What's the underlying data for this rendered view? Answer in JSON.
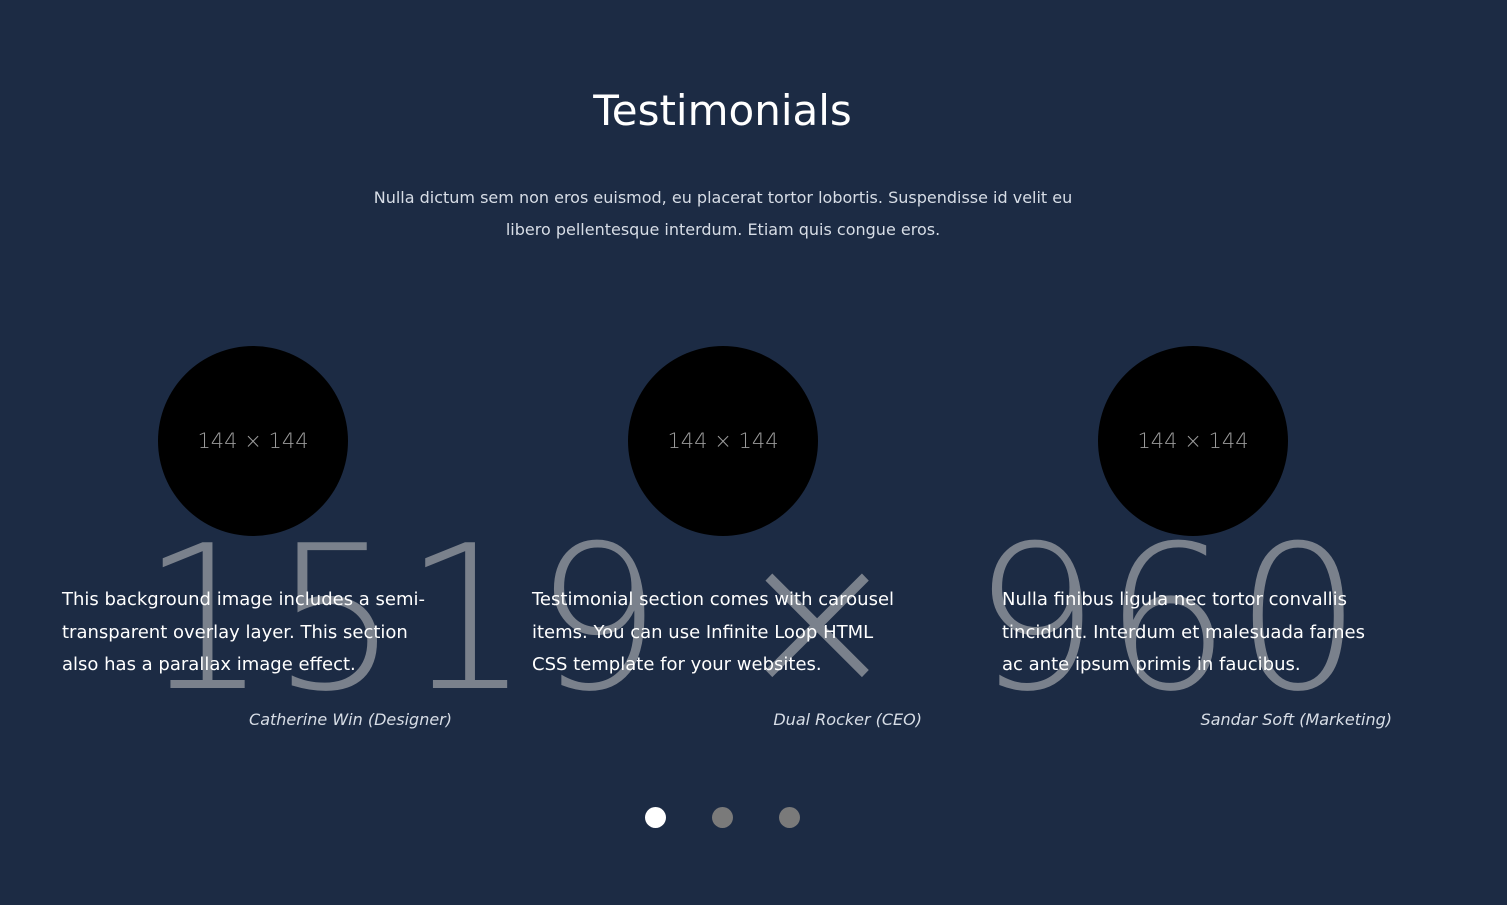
{
  "section": {
    "title": "Testimonials",
    "subtitle": "Nulla dictum sem non eros euismod, eu placerat tortor lobortis. Suspendisse id velit eu libero pellentesque interdum. Etiam quis congue eros.",
    "background_placeholder": "1519 × 960",
    "background_color": "#1c2b44"
  },
  "testimonials": [
    {
      "avatar_placeholder": "144 × 144",
      "quote": "This background image includes a semi-transparent overlay layer. This section also has a parallax image effect.",
      "author": "Catherine Win (Designer)"
    },
    {
      "avatar_placeholder": "144 × 144",
      "quote": "Testimonial section comes with carousel items. You can use Infinite Loop HTML CSS template for your websites.",
      "author": "Dual Rocker (CEO)"
    },
    {
      "avatar_placeholder": "144 × 144",
      "quote": "Nulla finibus ligula nec tortor convallis tincidunt. Interdum et malesuada fames ac ante ipsum primis in faucibus.",
      "author": "Sandar Soft (Marketing)"
    }
  ],
  "carousel": {
    "dot_count": 3,
    "active_index": 0
  }
}
